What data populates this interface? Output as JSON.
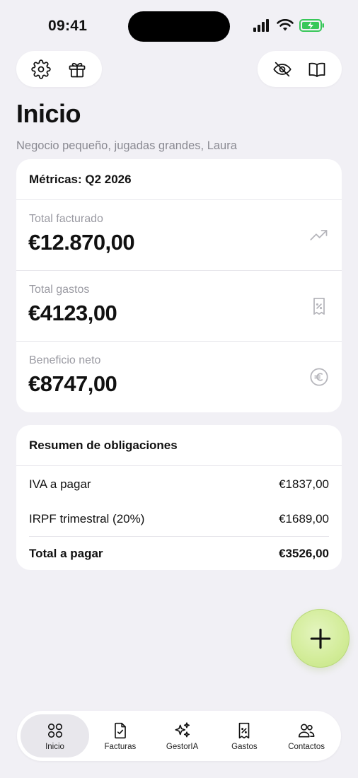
{
  "status_bar": {
    "time": "09:41"
  },
  "header": {
    "left_actions": [
      "gear-icon",
      "gift-icon"
    ],
    "right_actions": [
      "eye-off-icon",
      "book-icon"
    ]
  },
  "page": {
    "title": "Inicio",
    "subtitle": "Negocio pequeño, jugadas grandes, Laura"
  },
  "metrics": {
    "title": "Métricas: Q2 2026",
    "items": [
      {
        "label": "Total facturado",
        "value": "€12.870,00",
        "icon": "trending-up-icon"
      },
      {
        "label": "Total gastos",
        "value": "€4123,00",
        "icon": "receipt-percent-icon"
      },
      {
        "label": "Beneficio neto",
        "value": "€8747,00",
        "icon": "euro-circle-icon"
      }
    ]
  },
  "obligations": {
    "title": "Resumen de obligaciones",
    "rows": [
      {
        "label": "IVA a pagar",
        "value": "€1837,00"
      },
      {
        "label": "IRPF trimestral (20%)",
        "value": "€1689,00"
      }
    ],
    "total": {
      "label": "Total a pagar",
      "value": "€3526,00"
    }
  },
  "fab": {
    "icon": "plus-icon"
  },
  "tabs": [
    {
      "label": "Inicio",
      "icon": "grid-icon",
      "active": true
    },
    {
      "label": "Facturas",
      "icon": "document-check-icon",
      "active": false
    },
    {
      "label": "GestorIA",
      "icon": "sparkles-icon",
      "active": false
    },
    {
      "label": "Gastos",
      "icon": "receipt-percent-icon",
      "active": false
    },
    {
      "label": "Contactos",
      "icon": "users-icon",
      "active": false
    }
  ],
  "colors": {
    "background": "#F1F0F5",
    "card": "#FFFFFF",
    "fab": "#D2EC98",
    "battery": "#38C759",
    "muted_text": "#9A9AA2"
  }
}
